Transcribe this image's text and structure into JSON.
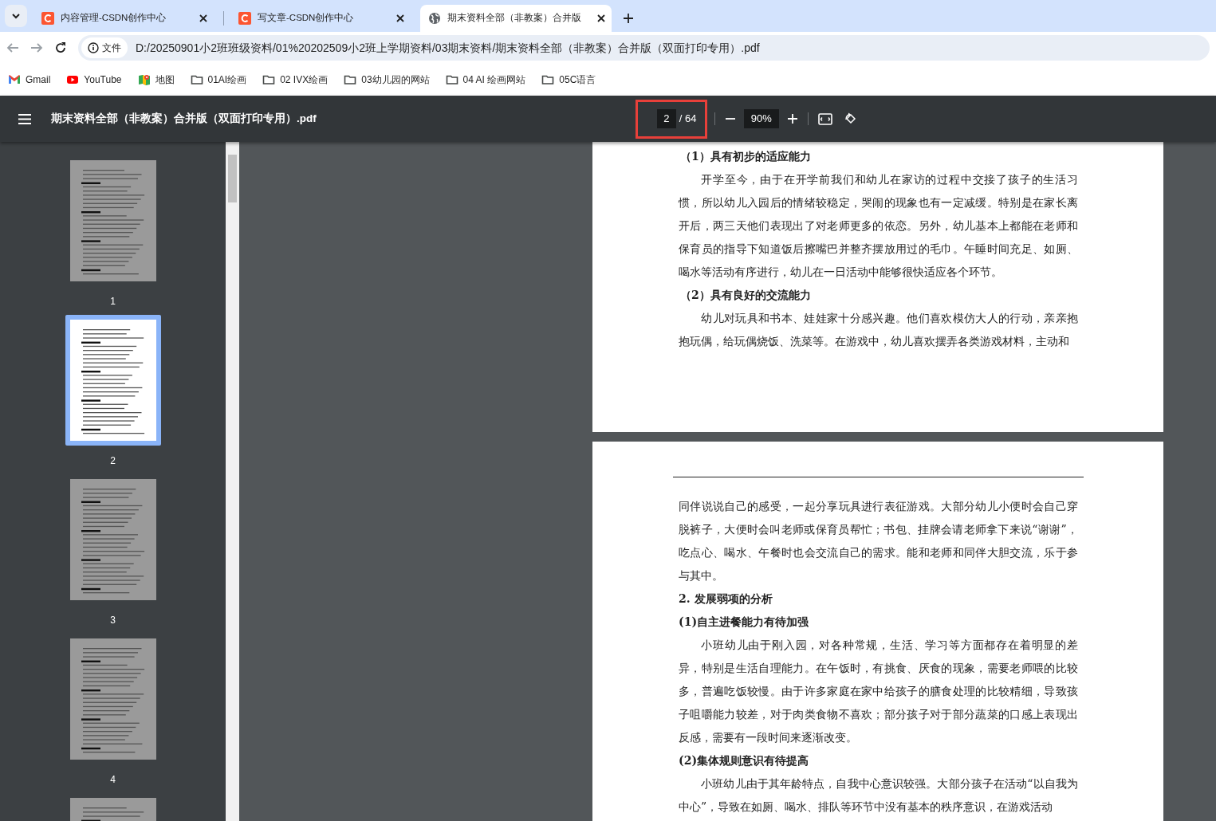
{
  "tabs": [
    {
      "title": "内容管理-CSDN创作中心",
      "kind": "csdn",
      "selected": false
    },
    {
      "title": "写文章-CSDN创作中心",
      "kind": "csdn",
      "selected": false
    },
    {
      "title": "期末资料全部（非教案）合并版",
      "kind": "globe",
      "selected": true
    }
  ],
  "address": {
    "scheme_label": "文件",
    "url": "D:/20250901小2班班级资料/01%20202509小2班上学期资料/03期末资料/期末资料全部（非教案）合并版（双面打印专用）.pdf"
  },
  "bookmarks": [
    {
      "label": "Gmail",
      "kind": "gmail"
    },
    {
      "label": "YouTube",
      "kind": "youtube"
    },
    {
      "label": "地图",
      "kind": "maps"
    },
    {
      "label": "01AI绘画",
      "kind": "folder"
    },
    {
      "label": "02 IVX绘画",
      "kind": "folder"
    },
    {
      "label": "03幼儿园的网站",
      "kind": "folder"
    },
    {
      "label": "04 AI 绘画网站",
      "kind": "folder"
    },
    {
      "label": "05C语言",
      "kind": "folder"
    }
  ],
  "viewer": {
    "title": "期末资料全部（非教案）合并版（双面打印专用）.pdf",
    "page_input": "2",
    "page_total": "/ 64",
    "zoom": "90%",
    "highlighted": true
  },
  "thumbnails": [
    {
      "label": "1",
      "selected": false
    },
    {
      "label": "2",
      "selected": true
    },
    {
      "label": "3",
      "selected": false
    },
    {
      "label": "4",
      "selected": false
    },
    {
      "selected": false
    }
  ],
  "pages": [
    {
      "blocks": [
        {
          "kind": "subheading",
          "text": "（1）具有初步的适应能力"
        },
        {
          "kind": "paragraph",
          "text": "开学至今，由于在开学前我们和幼儿在家访的过程中交接了孩子的生活习惯，所以幼儿入园后的情绪较稳定，哭闹的现象也有一定减缓。特别是在家长离开后，两三天他们表现出了对老师更多的依恋。另外，幼儿基本上都能在老师和保育员的指导下知道饭后擦嘴巴并整齐摆放用过的毛巾。午睡时间充足、如厕、喝水等活动有序进行，幼儿在一日活动中能够很快适应各个环节。"
        },
        {
          "kind": "subheading",
          "text": "（2）具有良好的交流能力"
        },
        {
          "kind": "paragraph",
          "text": "幼儿对玩具和书本、娃娃家十分感兴趣。他们喜欢模仿大人的行动，亲亲抱抱玩偶，给玩偶烧饭、洗菜等。在游戏中，幼儿喜欢摆弄各类游戏材料，主动和"
        }
      ]
    },
    {
      "blocks": [
        {
          "kind": "header_rule"
        },
        {
          "kind": "continuation",
          "text": "同伴说说自己的感受，一起分享玩具进行表征游戏。大部分幼儿小便时会自己穿脱裤子，大便时会叫老师或保育员帮忙；书包、挂牌会请老师拿下来说“谢谢”，吃点心、喝水、午餐时也会交流自己的需求。能和老师和同伴大胆交流，乐于参与其中。"
        },
        {
          "kind": "heading",
          "text": "2. 发展弱项的分析"
        },
        {
          "kind": "heading",
          "text": "(1)自主进餐能力有待加强"
        },
        {
          "kind": "paragraph",
          "text": "小班幼儿由于刚入园，对各种常规，生活、学习等方面都存在着明显的差异，特别是生活自理能力。在午饭时，有挑食、厌食的现象，需要老师喂的比较多，普遍吃饭较慢。由于许多家庭在家中给孩子的膳食处理的比较精细，导致孩子咀嚼能力较差，对于肉类食物不喜欢；部分孩子对于部分蔬菜的口感上表现出反感，需要有一段时间来逐渐改变。"
        },
        {
          "kind": "heading",
          "text": "(2)集体规则意识有待提高"
        },
        {
          "kind": "paragraph",
          "text": "小班幼儿由于其年龄特点，自我中心意识较强。大部分孩子在活动“以自我为中心”，导致在如厕、喝水、排队等环节中没有基本的秩序意识，在游戏活动"
        }
      ]
    }
  ]
}
